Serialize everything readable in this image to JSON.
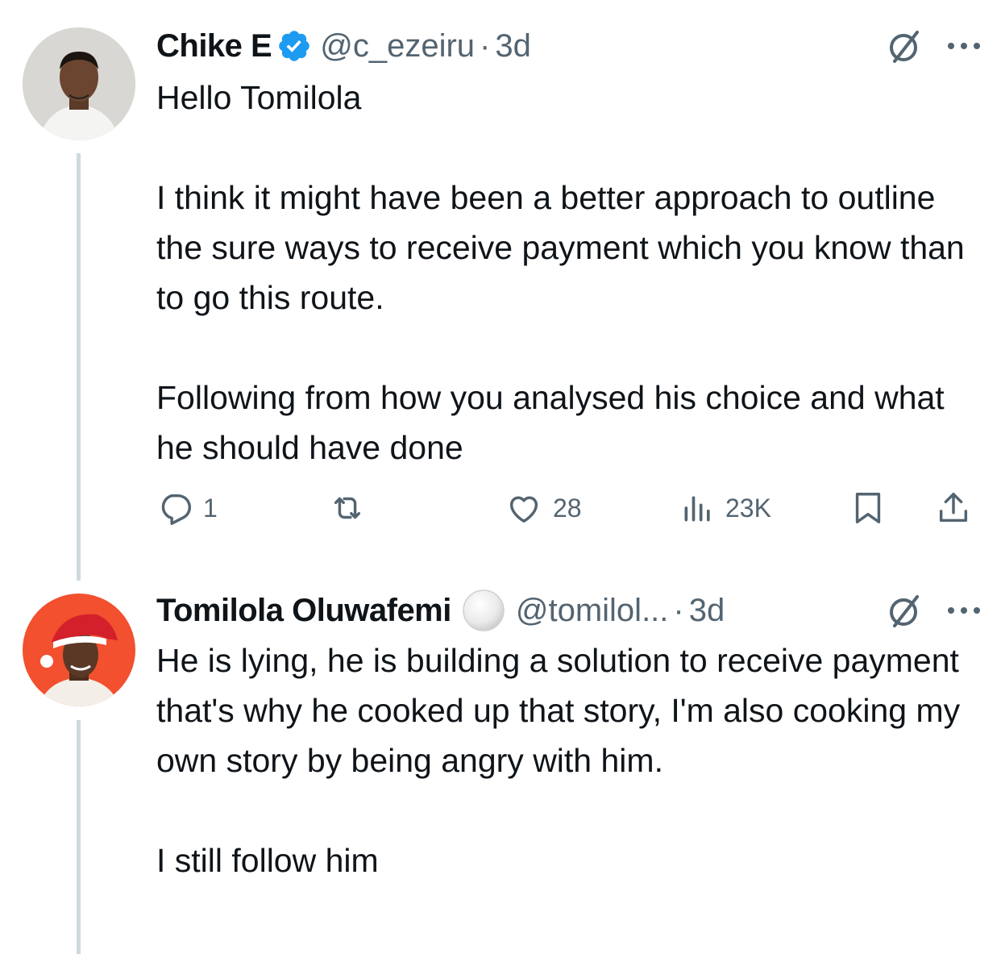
{
  "tweet1": {
    "name": "Chike E",
    "handle": "@c_ezeiru",
    "separator": "·",
    "time": "3d",
    "text": "Hello Tomilola\n\nI think it might have been a better approach to outline the sure ways to receive payment which you know than to go this route.\n\nFollowing from how you analysed his choice and what he should have done",
    "actions": {
      "reply_count": "1",
      "retweet_count": "",
      "like_count": "28",
      "views_count": "23K"
    },
    "icons": [
      "verified-icon",
      "grok-slash-icon",
      "more-icon",
      "reply-icon",
      "retweet-icon",
      "like-icon",
      "views-icon",
      "bookmark-icon",
      "share-icon"
    ]
  },
  "tweet2": {
    "name": "Tomilola Oluwafemi",
    "handle": "@tomilol...",
    "separator": "·",
    "time": "3d",
    "text": "He is lying, he is building a solution to receive payment that's why he cooked up that story, I'm also cooking my own story by being angry with him.\n\nI still follow him",
    "icons": [
      "white-circle-emoji-icon",
      "grok-slash-icon",
      "more-icon"
    ]
  },
  "colors": {
    "text": "#0f1419",
    "secondary": "#536471",
    "verified": "#1d9bf0",
    "thread_line": "#cfd9de"
  }
}
